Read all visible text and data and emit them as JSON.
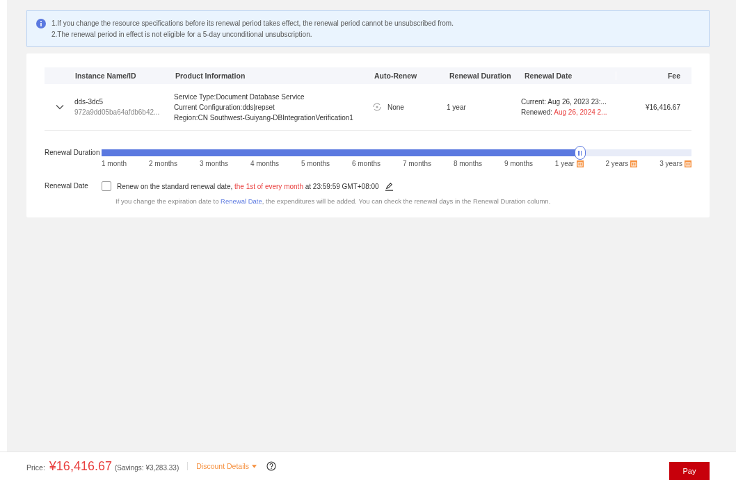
{
  "notice": {
    "lines": [
      "1.If you change the resource specifications before its renewal period takes effect, the renewal period cannot be unsubscribed from.",
      "2.The renewal period in effect is not eligible for a 5-day unconditional unsubscription."
    ]
  },
  "table": {
    "columns": [
      "Instance Name/ID",
      "Product Information",
      "Auto-Renew",
      "Renewal Duration",
      "Renewal Date",
      "Fee"
    ],
    "rows": [
      {
        "expanded": false,
        "name": "dds-3dc5",
        "id": "972a9dd05ba64afdb6b42...",
        "product_info": [
          "Service Type:Document Database Service",
          "Current Configuration:dds|repset",
          "Region:CN Southwest-Guiyang-DBIntegrationVerification1"
        ],
        "auto_renew": "None",
        "duration": "1 year",
        "current_label": "Current:",
        "current_date": "Aug 26, 2023 23:...",
        "renewed_label": "Renewed:",
        "renewed_date": "Aug 26, 2024 2...",
        "fee": "¥16,416.67"
      }
    ]
  },
  "renewal_duration": {
    "label": "Renewal Duration",
    "level": 0.81,
    "options": [
      {
        "label": "1 month",
        "discount": false
      },
      {
        "label": "2 months",
        "discount": false
      },
      {
        "label": "3 months",
        "discount": false
      },
      {
        "label": "4 months",
        "discount": false
      },
      {
        "label": "5 months",
        "discount": false
      },
      {
        "label": "6 months",
        "discount": false
      },
      {
        "label": "7 months",
        "discount": false
      },
      {
        "label": "8 months",
        "discount": false
      },
      {
        "label": "9 months",
        "discount": false
      },
      {
        "label": "1 year",
        "discount": true
      },
      {
        "label": "2 years",
        "discount": true
      },
      {
        "label": "3 years",
        "discount": true
      }
    ]
  },
  "renewal_date": {
    "label": "Renewal Date",
    "checked": false,
    "text_before": "Renew on the standard renewal date, ",
    "text_highlight": "the 1st of every month",
    "text_after": " at 23:59:59 GMT+08:00",
    "hint_before": "If you change the expiration date to ",
    "hint_link": "Renewal Date",
    "hint_after": ", the expenditures will be added. You can check the renewal days in the Renewal Duration column."
  },
  "footer": {
    "price_label": "Price:",
    "price": "¥16,416.67",
    "savings": "(Savings: ¥3,283.33)",
    "discount_details": "Discount Details",
    "pay": "Pay"
  }
}
